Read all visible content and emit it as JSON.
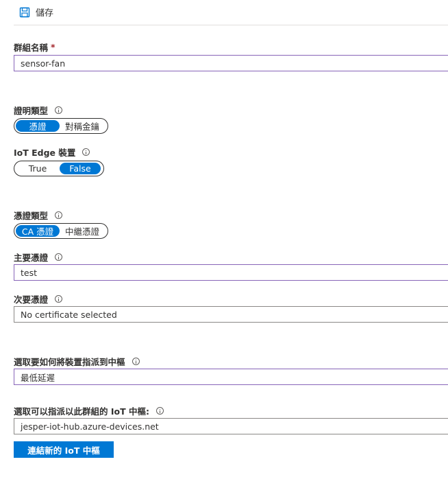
{
  "toolbar": {
    "save_label": "儲存",
    "save_icon": "save-icon"
  },
  "group_name": {
    "label": "群組名稱",
    "required_mark": "*",
    "value": "sensor-fan"
  },
  "attestation_type": {
    "label": "證明類型",
    "options": [
      "憑證",
      "對稱金鑰"
    ],
    "selected": "憑證"
  },
  "iot_edge": {
    "label": "IoT Edge 裝置",
    "options": [
      "True",
      "False"
    ],
    "selected": "False"
  },
  "certificate_type": {
    "label": "憑證類型",
    "options": [
      "CA 憑證",
      "中繼憑證"
    ],
    "selected": "CA 憑證"
  },
  "primary_certificate": {
    "label": "主要憑證",
    "value": "test"
  },
  "secondary_certificate": {
    "label": "次要憑證",
    "value": "No certificate selected"
  },
  "allocation_policy": {
    "label": "選取要如何將裝置指派到中樞",
    "value": "最低延遲"
  },
  "iot_hubs": {
    "label": "選取可以指派以此群組的 IoT 中樞:",
    "value": "jesper-iot-hub.azure-devices.net",
    "link_button_label": "連結新的 IoT 中樞"
  },
  "colors": {
    "accent": "#0078d4",
    "focus_border": "#8764b8",
    "required": "#a4262c"
  }
}
